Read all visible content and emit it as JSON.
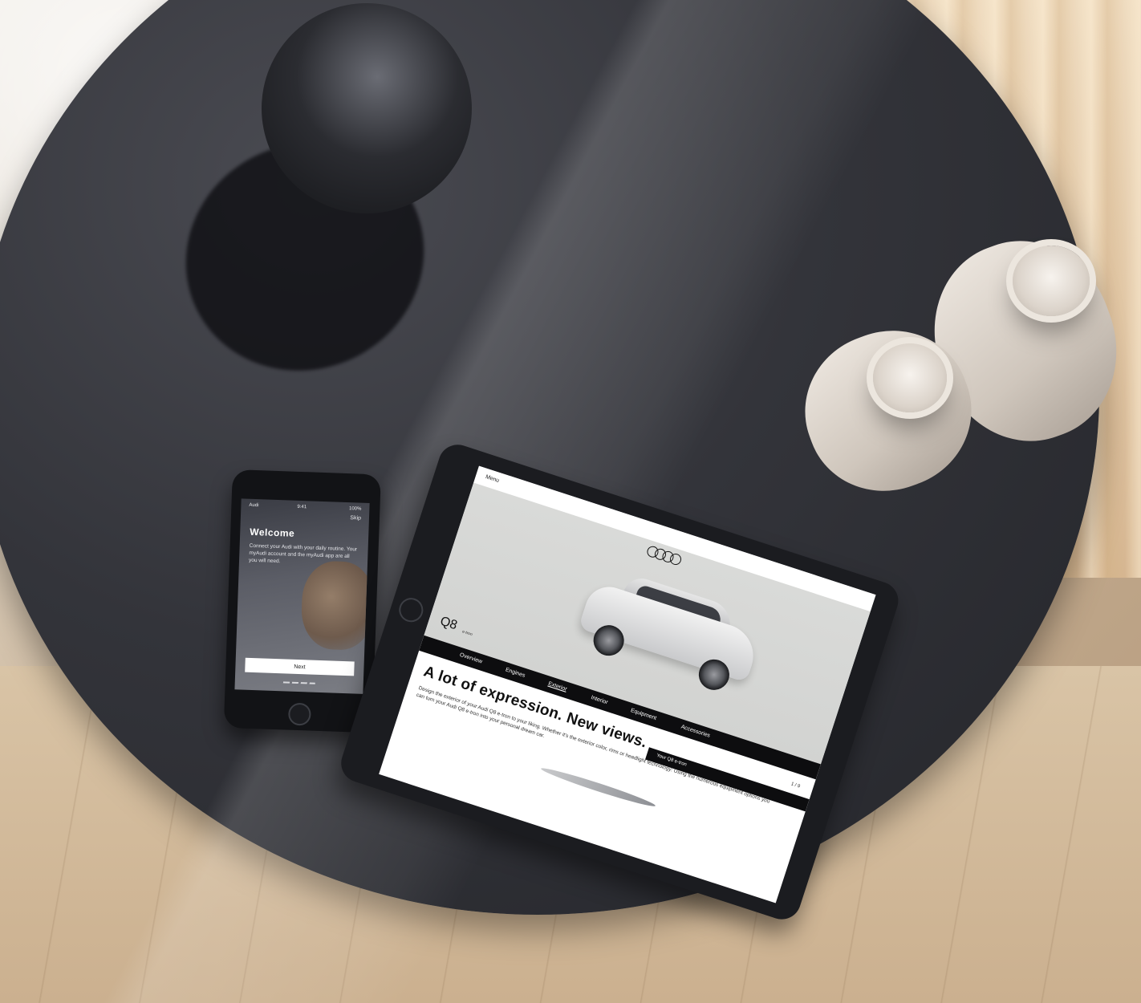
{
  "phone": {
    "status_time": "9:41",
    "status_carrier": "Audi",
    "status_battery": "100%",
    "skip_label": "Skip",
    "title": "Welcome",
    "intro_text": "Connect your Audi with your daily routine. Your myAudi account and the myAudi app are all you will need.",
    "next_label": "Next"
  },
  "tablet": {
    "menu_label": "Menu",
    "model_name": "Q8",
    "model_suffix": "e-tron",
    "nav_items": [
      {
        "label": "Overview"
      },
      {
        "label": "Engines"
      },
      {
        "label": "Exterior"
      },
      {
        "label": "Interior"
      },
      {
        "label": "Equipment"
      },
      {
        "label": "Accessories"
      }
    ],
    "headline": "A lot of expression. New views.",
    "body_text": "Design the exterior of your Audi Q8 e-tron to your liking. Whether it's the exterior color, rims or headlight technology: Using the numerous equipment options you can turn your Audi Q8 e-tron into your personal dream car.",
    "pager": "1 / 9",
    "bar_label": "Your Q8 e-tron"
  },
  "colors": {
    "table_top": "#33343a",
    "tablet_nav": "#0d0d0f",
    "hero_bg": "#d9dad8"
  }
}
